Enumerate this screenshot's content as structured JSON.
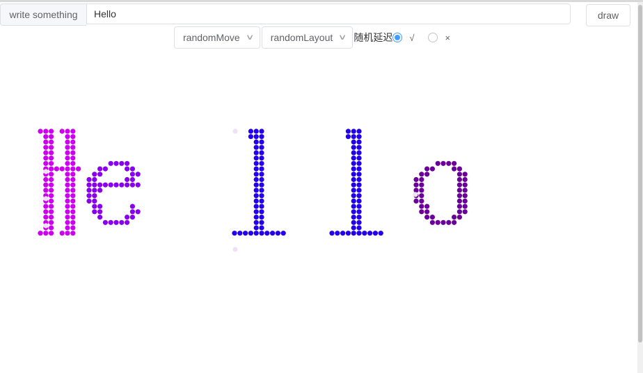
{
  "input": {
    "addon_label": "write something",
    "value": "Hello"
  },
  "draw_button": {
    "label": "draw"
  },
  "controls": {
    "move_select": "randomMove",
    "layout_select": "randomLayout",
    "delay_label": "随机延迟",
    "delay_options": [
      {
        "label": "√",
        "selected": true
      },
      {
        "label": "×",
        "selected": false
      }
    ]
  },
  "art": {
    "text": "Hello",
    "letter_colors": [
      "#cc00ee",
      "#8800ee",
      "#2200ee",
      "#2200ee",
      "#6a0099"
    ],
    "faded_color": "#f0e0f8"
  }
}
